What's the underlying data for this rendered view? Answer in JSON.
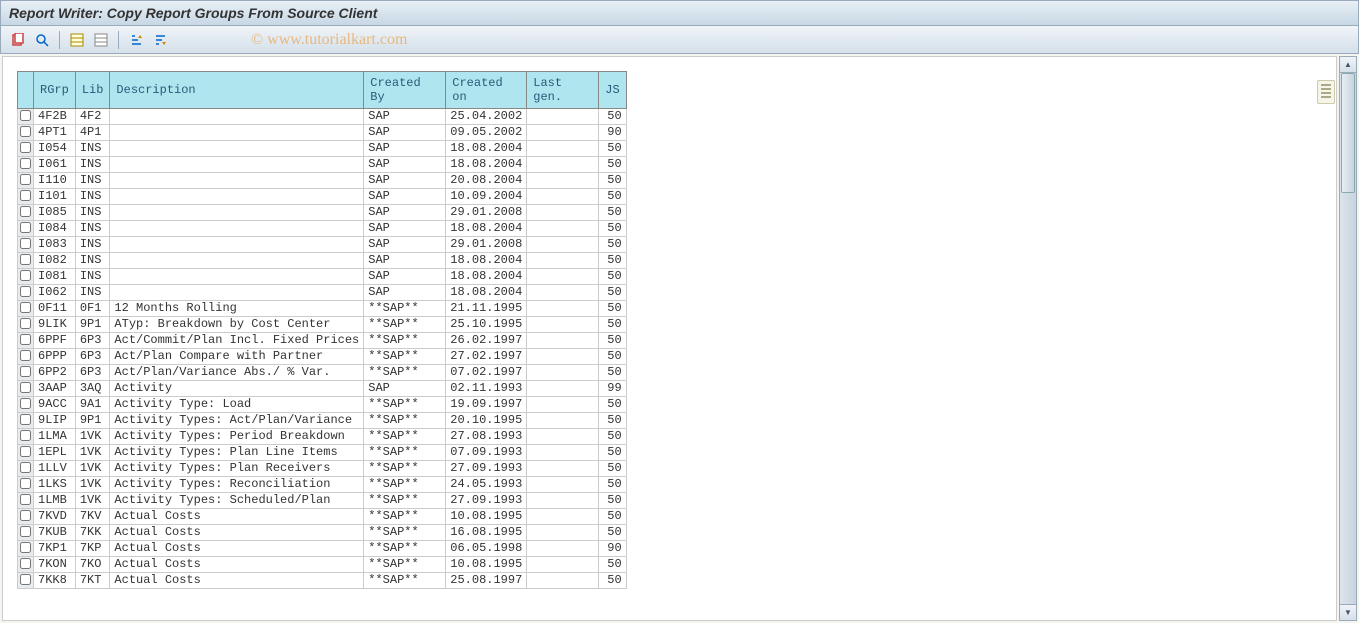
{
  "title": "Report Writer: Copy Report Groups From Source Client",
  "watermark": "© www.tutorialkart.com",
  "headers": {
    "rgrp": "RGrp",
    "lib": "Lib",
    "desc": "Description",
    "cby": "Created By",
    "con": "Created on",
    "lgen": "Last gen.",
    "js": "JS"
  },
  "rows": [
    {
      "rgrp": "4F2B",
      "lib": "4F2",
      "desc": "",
      "cby": "SAP",
      "con": "25.04.2002",
      "lgen": "",
      "js": "50"
    },
    {
      "rgrp": "4PT1",
      "lib": "4P1",
      "desc": "",
      "cby": "SAP",
      "con": "09.05.2002",
      "lgen": "",
      "js": "90"
    },
    {
      "rgrp": "I054",
      "lib": "INS",
      "desc": "",
      "cby": "SAP",
      "con": "18.08.2004",
      "lgen": "",
      "js": "50"
    },
    {
      "rgrp": "I061",
      "lib": "INS",
      "desc": "",
      "cby": "SAP",
      "con": "18.08.2004",
      "lgen": "",
      "js": "50"
    },
    {
      "rgrp": "I110",
      "lib": "INS",
      "desc": "",
      "cby": "SAP",
      "con": "20.08.2004",
      "lgen": "",
      "js": "50"
    },
    {
      "rgrp": "I101",
      "lib": "INS",
      "desc": "",
      "cby": "SAP",
      "con": "10.09.2004",
      "lgen": "",
      "js": "50"
    },
    {
      "rgrp": "I085",
      "lib": "INS",
      "desc": "",
      "cby": "SAP",
      "con": "29.01.2008",
      "lgen": "",
      "js": "50"
    },
    {
      "rgrp": "I084",
      "lib": "INS",
      "desc": "",
      "cby": "SAP",
      "con": "18.08.2004",
      "lgen": "",
      "js": "50"
    },
    {
      "rgrp": "I083",
      "lib": "INS",
      "desc": "",
      "cby": "SAP",
      "con": "29.01.2008",
      "lgen": "",
      "js": "50"
    },
    {
      "rgrp": "I082",
      "lib": "INS",
      "desc": "",
      "cby": "SAP",
      "con": "18.08.2004",
      "lgen": "",
      "js": "50"
    },
    {
      "rgrp": "I081",
      "lib": "INS",
      "desc": "",
      "cby": "SAP",
      "con": "18.08.2004",
      "lgen": "",
      "js": "50"
    },
    {
      "rgrp": "I062",
      "lib": "INS",
      "desc": "",
      "cby": "SAP",
      "con": "18.08.2004",
      "lgen": "",
      "js": "50"
    },
    {
      "rgrp": "0F11",
      "lib": "0F1",
      "desc": "12 Months Rolling",
      "cby": "**SAP**",
      "con": "21.11.1995",
      "lgen": "",
      "js": "50"
    },
    {
      "rgrp": "9LIK",
      "lib": "9P1",
      "desc": "ATyp: Breakdown by Cost Center",
      "cby": "**SAP**",
      "con": "25.10.1995",
      "lgen": "",
      "js": "50"
    },
    {
      "rgrp": "6PPF",
      "lib": "6P3",
      "desc": "Act/Commit/Plan Incl. Fixed Prices",
      "cby": "**SAP**",
      "con": "26.02.1997",
      "lgen": "",
      "js": "50"
    },
    {
      "rgrp": "6PPP",
      "lib": "6P3",
      "desc": "Act/Plan Compare with Partner",
      "cby": "**SAP**",
      "con": "27.02.1997",
      "lgen": "",
      "js": "50"
    },
    {
      "rgrp": "6PP2",
      "lib": "6P3",
      "desc": "Act/Plan/Variance Abs./ % Var.",
      "cby": "**SAP**",
      "con": "07.02.1997",
      "lgen": "",
      "js": "50"
    },
    {
      "rgrp": "3AAP",
      "lib": "3AQ",
      "desc": "Activity",
      "cby": "SAP",
      "con": "02.11.1993",
      "lgen": "",
      "js": "99"
    },
    {
      "rgrp": "9ACC",
      "lib": "9A1",
      "desc": "Activity Type: Load",
      "cby": "**SAP**",
      "con": "19.09.1997",
      "lgen": "",
      "js": "50"
    },
    {
      "rgrp": "9LIP",
      "lib": "9P1",
      "desc": "Activity Types: Act/Plan/Variance",
      "cby": "**SAP**",
      "con": "20.10.1995",
      "lgen": "",
      "js": "50"
    },
    {
      "rgrp": "1LMA",
      "lib": "1VK",
      "desc": "Activity Types: Period Breakdown",
      "cby": "**SAP**",
      "con": "27.08.1993",
      "lgen": "",
      "js": "50"
    },
    {
      "rgrp": "1EPL",
      "lib": "1VK",
      "desc": "Activity Types: Plan Line Items",
      "cby": "**SAP**",
      "con": "07.09.1993",
      "lgen": "",
      "js": "50"
    },
    {
      "rgrp": "1LLV",
      "lib": "1VK",
      "desc": "Activity Types: Plan Receivers",
      "cby": "**SAP**",
      "con": "27.09.1993",
      "lgen": "",
      "js": "50"
    },
    {
      "rgrp": "1LKS",
      "lib": "1VK",
      "desc": "Activity Types: Reconciliation",
      "cby": "**SAP**",
      "con": "24.05.1993",
      "lgen": "",
      "js": "50"
    },
    {
      "rgrp": "1LMB",
      "lib": "1VK",
      "desc": "Activity Types: Scheduled/Plan",
      "cby": "**SAP**",
      "con": "27.09.1993",
      "lgen": "",
      "js": "50"
    },
    {
      "rgrp": "7KVD",
      "lib": "7KV",
      "desc": "Actual Costs",
      "cby": "**SAP**",
      "con": "10.08.1995",
      "lgen": "",
      "js": "50"
    },
    {
      "rgrp": "7KUB",
      "lib": "7KK",
      "desc": "Actual Costs",
      "cby": "**SAP**",
      "con": "16.08.1995",
      "lgen": "",
      "js": "50"
    },
    {
      "rgrp": "7KP1",
      "lib": "7KP",
      "desc": "Actual Costs",
      "cby": "**SAP**",
      "con": "06.05.1998",
      "lgen": "",
      "js": "90"
    },
    {
      "rgrp": "7KON",
      "lib": "7KO",
      "desc": "Actual Costs",
      "cby": "**SAP**",
      "con": "10.08.1995",
      "lgen": "",
      "js": "50"
    },
    {
      "rgrp": "7KK8",
      "lib": "7KT",
      "desc": "Actual Costs",
      "cby": "**SAP**",
      "con": "25.08.1997",
      "lgen": "",
      "js": "50"
    }
  ]
}
